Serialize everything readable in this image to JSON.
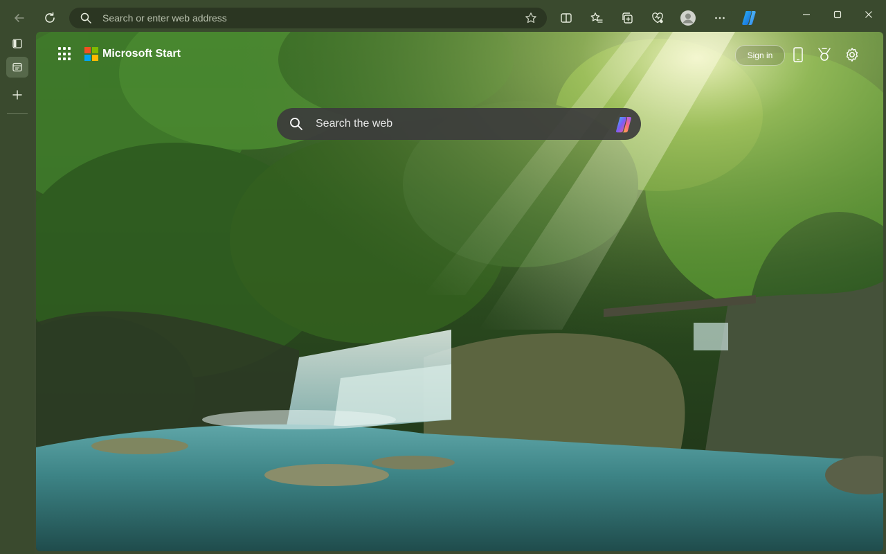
{
  "browser": {
    "address_placeholder": "Search or enter web address",
    "toolbar_icons": [
      "back-icon",
      "refresh-icon",
      "split-screen-icon",
      "favorites-icon",
      "collections-icon",
      "browser-essentials-icon",
      "profile-icon",
      "more-icon",
      "copilot-icon"
    ],
    "window_controls": [
      "minimize-icon",
      "maximize-icon",
      "close-icon"
    ],
    "sidebar_icons": [
      "tab-actions-icon",
      "tab-icon",
      "new-tab-icon"
    ]
  },
  "page": {
    "brand": "Microsoft Start",
    "sign_in_label": "Sign in",
    "search_placeholder": "Search the web",
    "header_icons": [
      "mobile-icon",
      "rewards-icon",
      "settings-icon"
    ]
  },
  "colors": {
    "frame": "#3a4a2e",
    "ms_red": "#f25022",
    "ms_green": "#7fba00",
    "ms_blue": "#00a4ef",
    "ms_yellow": "#ffb900"
  }
}
